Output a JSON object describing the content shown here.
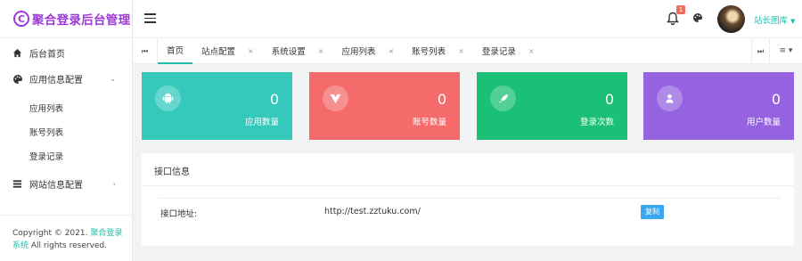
{
  "app": {
    "logo_letter": "C",
    "title": "聚合登录后台管理"
  },
  "sidebar": {
    "home": "后台首页",
    "app_config": "应用信息配置",
    "app_config_items": [
      "应用列表",
      "账号列表",
      "登录记录"
    ],
    "site_config": "网站信息配置",
    "copyright_prefix": "Copyright © 2021.",
    "copyright_link": "聚合登录系统",
    "copyright_suffix": "All rights reserved."
  },
  "header": {
    "notification_count": "1",
    "username": "站长图库"
  },
  "tabs": [
    "首页",
    "站点配置",
    "系统设置",
    "应用列表",
    "账号列表",
    "登录记录"
  ],
  "stats": [
    {
      "value": "0",
      "label": "应用数量",
      "color": "#35c9bb"
    },
    {
      "value": "0",
      "label": "账号数量",
      "color": "#f56b6b"
    },
    {
      "value": "0",
      "label": "登录次数",
      "color": "#19c075"
    },
    {
      "value": "0",
      "label": "用户数量",
      "color": "#9563e0"
    }
  ],
  "api_info": {
    "title": "接口信息",
    "address_label": "接口地址:",
    "address_value": "http://test.zztuku.com/",
    "copy_label": "复制"
  },
  "colors": {
    "accent": "#1fbfa9",
    "brand": "#9c3ad8"
  }
}
